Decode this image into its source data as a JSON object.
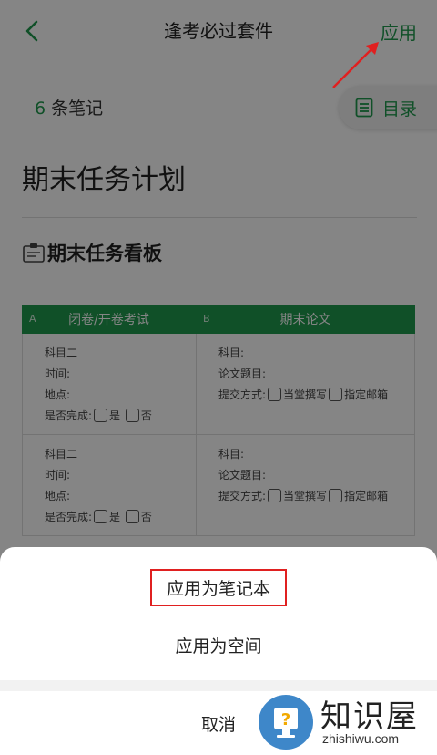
{
  "header": {
    "title": "逢考必过套件",
    "apply_label": "应用"
  },
  "meta": {
    "count_number": "6",
    "count_unit": "条笔记",
    "toc_label": "目录"
  },
  "document": {
    "title": "期末任务计划",
    "board_title": "期末任务看板"
  },
  "table": {
    "columns": [
      {
        "letter": "A",
        "header": "闭卷/开卷考试"
      },
      {
        "letter": "B",
        "header": "期末论文"
      }
    ],
    "rows": [
      {
        "a": {
          "l1": "科目二",
          "l2": "时间:",
          "l3": "地点:",
          "l4": "是否完成:",
          "opt_yes": "是",
          "opt_no": "否"
        },
        "b": {
          "l1": "科目:",
          "l2": "论文题目:",
          "l3": "提交方式:",
          "opt_1": "当堂撰写",
          "opt_2": "指定邮箱"
        }
      },
      {
        "a": {
          "l1": "科目二",
          "l2": "时间:",
          "l3": "地点:",
          "l4": "是否完成:",
          "opt_yes": "是",
          "opt_no": "否"
        },
        "b": {
          "l1": "科目:",
          "l2": "论文题目:",
          "l3": "提交方式:",
          "opt_1": "当堂撰写",
          "opt_2": "指定邮箱"
        }
      }
    ]
  },
  "sheet": {
    "option_notebook": "应用为笔记本",
    "option_space": "应用为空间",
    "cancel": "取消"
  },
  "watermark": {
    "brand": "知识屋",
    "domain": "zhishiwu.com"
  },
  "colors": {
    "accent": "#1f9a4e",
    "highlight_box": "#e02020",
    "annotation_arrow": "#e02020"
  }
}
